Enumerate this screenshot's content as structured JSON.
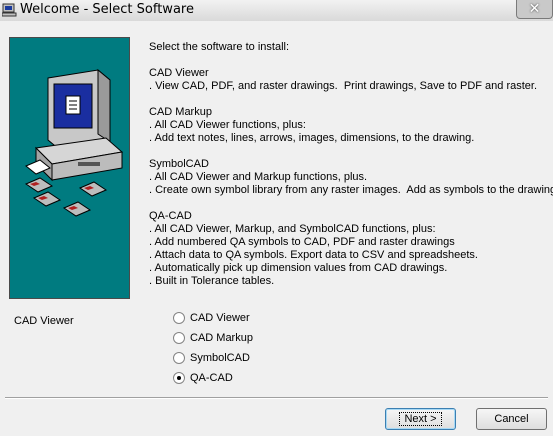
{
  "window": {
    "title": "Welcome - Select Software",
    "icon": "installer-icon",
    "close_glyph": "✕"
  },
  "description": {
    "intro": "Select the software to install:",
    "sections": [
      {
        "heading": "CAD Viewer",
        "lines": [
          ". View CAD, PDF, and raster drawings.  Print drawings, Save to PDF and raster."
        ]
      },
      {
        "heading": "CAD Markup",
        "lines": [
          ". All CAD Viewer functions, plus:",
          ". Add text notes, lines, arrows, images, dimensions, to the drawing."
        ]
      },
      {
        "heading": "SymbolCAD",
        "lines": [
          ". All CAD Viewer and Markup functions, plus.",
          ". Create own symbol library from any raster images.  Add as symbols to the drawing."
        ]
      },
      {
        "heading": "QA-CAD",
        "lines": [
          ". All CAD Viewer, Markup, and SymbolCAD functions, plus:",
          ". Add numbered QA symbols to CAD, PDF and raster drawings",
          ". Attach data to QA symbols. Export data to CSV and spreadsheets.",
          ". Automatically pick up dimension values from CAD drawings.",
          ". Built in Tolerance tables."
        ]
      }
    ]
  },
  "selected_label": "CAD Viewer",
  "options": [
    {
      "label": "CAD Viewer",
      "checked": false
    },
    {
      "label": "CAD Markup",
      "checked": false
    },
    {
      "label": "SymbolCAD",
      "checked": false
    },
    {
      "label": "QA-CAD",
      "checked": true
    }
  ],
  "buttons": {
    "next": "Next >",
    "cancel": "Cancel"
  },
  "colors": {
    "banner": "#007b80",
    "client": "#f0f0f0"
  }
}
